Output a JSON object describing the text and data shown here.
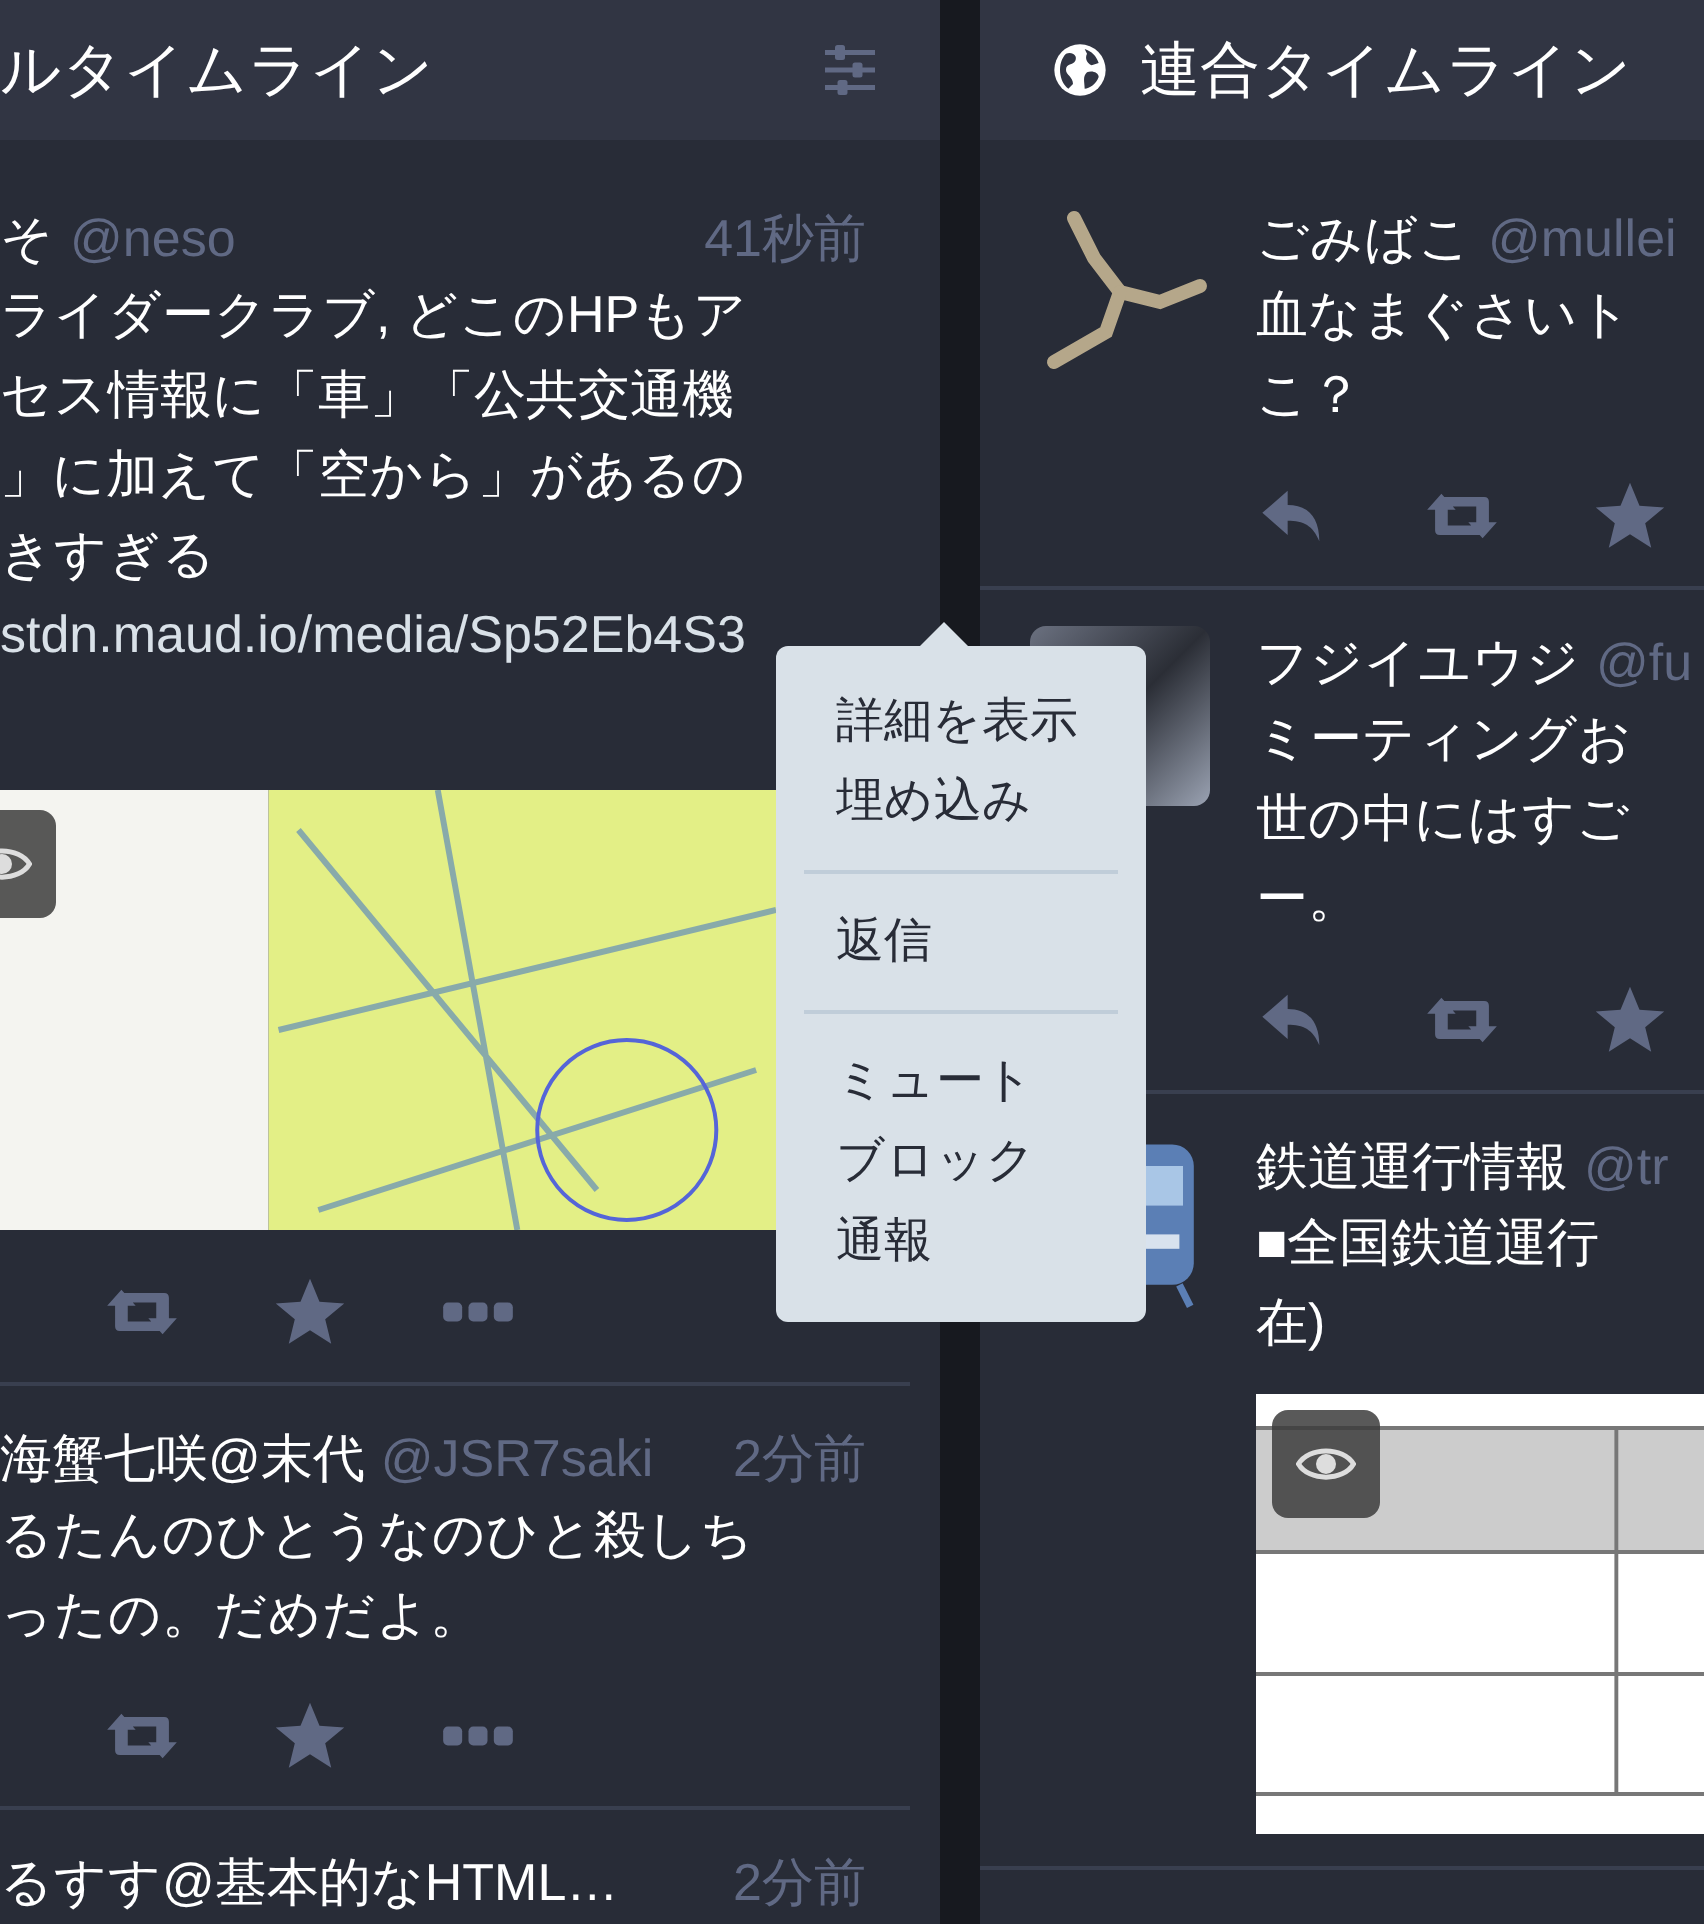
{
  "columns": [
    {
      "kind": "local",
      "title": "ルタイムライン",
      "statuses": [
        {
          "kind": "plain",
          "name": "そ",
          "handle": "@neso",
          "time": "41秒前",
          "lines": [
            "ライダークラブ, どこのHPもア",
            "セス情報に「車」「公共交通機",
            "」に加えて「空から」があるの",
            "きすぎる"
          ],
          "link": "stdn.maud.io/media/Sp52Eb4S3",
          "media": {
            "kind": "map"
          },
          "action_bar": true
        },
        {
          "kind": "plain",
          "name": "海蟹七咲@末代",
          "handle": "@JSR7saki",
          "time": "2分前",
          "lines": [
            "るたんのひとうなのひと殺しち",
            "ったの。だめだよ。"
          ],
          "action_bar": true
        },
        {
          "kind": "plain",
          "name": "るすす@基本的なHTML…",
          "time": "2分前",
          "action_bar": false
        }
      ]
    },
    {
      "kind": "federated",
      "title": "連合タイムライン",
      "statuses": [
        {
          "kind": "triskelion",
          "name": "ごみばこ",
          "handle": "@mullei",
          "lines": [
            "血なまぐさいト",
            "こ？"
          ],
          "action_bar": true
        },
        {
          "kind": "photo",
          "name": "フジイユウジ",
          "handle": "@fu",
          "lines": [
            "ミーティングお",
            "世の中にはすご",
            "ー。"
          ],
          "action_bar": true
        },
        {
          "kind": "train",
          "name": "鉄道運行情報",
          "handle": "@tr",
          "lines": [
            "■全国鉄道運行",
            "在)"
          ],
          "media": {
            "kind": "table"
          },
          "action_bar": false
        }
      ]
    }
  ],
  "menu": {
    "items": [
      {
        "label": "詳細を表示",
        "divider_after": false
      },
      {
        "label": "埋め込み",
        "divider_after": true
      },
      {
        "label": "返信",
        "divider_after": true
      },
      {
        "label": "ミュート",
        "divider_after": false
      },
      {
        "label": "ブロック",
        "divider_after": false
      },
      {
        "label": "通報",
        "divider_after": false
      }
    ]
  }
}
